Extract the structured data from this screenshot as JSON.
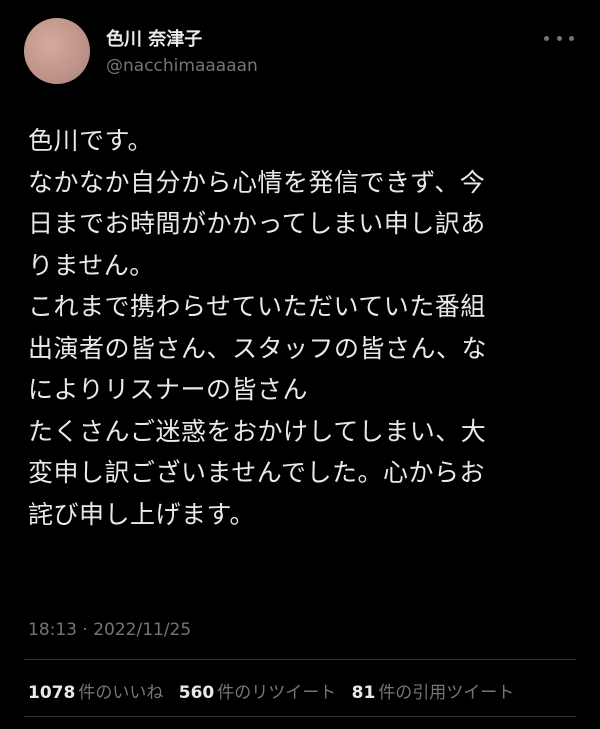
{
  "user": {
    "display_name": "色川 奈津子",
    "handle": "@nacchimaaaaan"
  },
  "tweet": {
    "lines": [
      "色川です。",
      "なかなか自分から心情を発信できず、今",
      "日までお時間がかかってしまい申し訳あ",
      "りません。",
      "これまで携わらせていただいていた番組",
      "出演者の皆さん、スタッフの皆さん、な",
      "によりリスナーの皆さん",
      "たくさんご迷惑をおかけしてしまい、大",
      "変申し訳ございませんでした。心からお",
      "詫び申し上げます。"
    ],
    "timestamp": "18:13 · 2022/11/25"
  },
  "stats": [
    {
      "count": "1078",
      "label": "件のいいね"
    },
    {
      "count": "560",
      "label": "件のリツイート"
    },
    {
      "count": "81",
      "label": "件の引用ツイート"
    }
  ],
  "icons": {
    "more": "more-horizontal-icon"
  }
}
